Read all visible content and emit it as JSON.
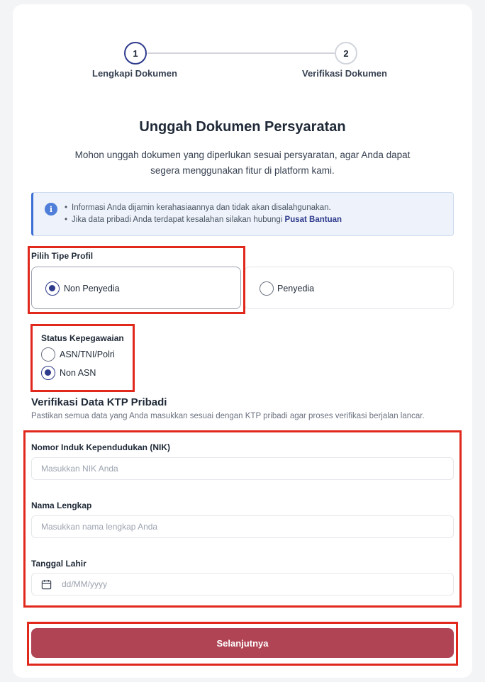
{
  "stepper": {
    "steps": [
      {
        "number": "1",
        "label": "Lengkapi Dokumen"
      },
      {
        "number": "2",
        "label": "Verifikasi Dokumen"
      }
    ]
  },
  "header": {
    "title": "Unggah Dokumen Persyaratan",
    "description": "Mohon unggah dokumen yang diperlukan sesuai persyaratan, agar Anda dapat segera menggunakan fitur di platform kami."
  },
  "info": {
    "icon": "info-icon",
    "line1": "Informasi Anda dijamin kerahasiaannya dan tidak akan disalahgunakan.",
    "line2": "Jika data pribadi Anda terdapat kesalahan silakan hubungi",
    "link": "Pusat Bantuan"
  },
  "profile_type": {
    "label": "Pilih Tipe Profil",
    "options": [
      {
        "label": "Non Penyedia",
        "selected": true
      },
      {
        "label": "Penyedia",
        "selected": false
      }
    ]
  },
  "employment_status": {
    "label": "Status Kepegawaian",
    "options": [
      {
        "label": "ASN/TNI/Polri",
        "selected": false
      },
      {
        "label": "Non ASN",
        "selected": true
      }
    ]
  },
  "ktp": {
    "title": "Verifikasi Data KTP Pribadi",
    "description": "Pastikan semua data yang Anda masukkan sesuai dengan KTP pribadi agar proses verifikasi berjalan lancar.",
    "fields": {
      "nik": {
        "label": "Nomor Induk Kependudukan (NIK)",
        "placeholder": "Masukkan NIK Anda",
        "value": ""
      },
      "name": {
        "label": "Nama Lengkap",
        "placeholder": "Masukkan nama lengkap Anda",
        "value": ""
      },
      "dob": {
        "label": "Tanggal Lahir",
        "placeholder": "dd/MM/yyyy",
        "value": "",
        "icon": "calendar-icon"
      }
    }
  },
  "submit": {
    "label": "Selanjutnya"
  },
  "colors": {
    "primary": "#2e3a8c",
    "submit_bg": "#b04455",
    "highlight": "#e0281d",
    "info_bg": "#eef3fb"
  }
}
